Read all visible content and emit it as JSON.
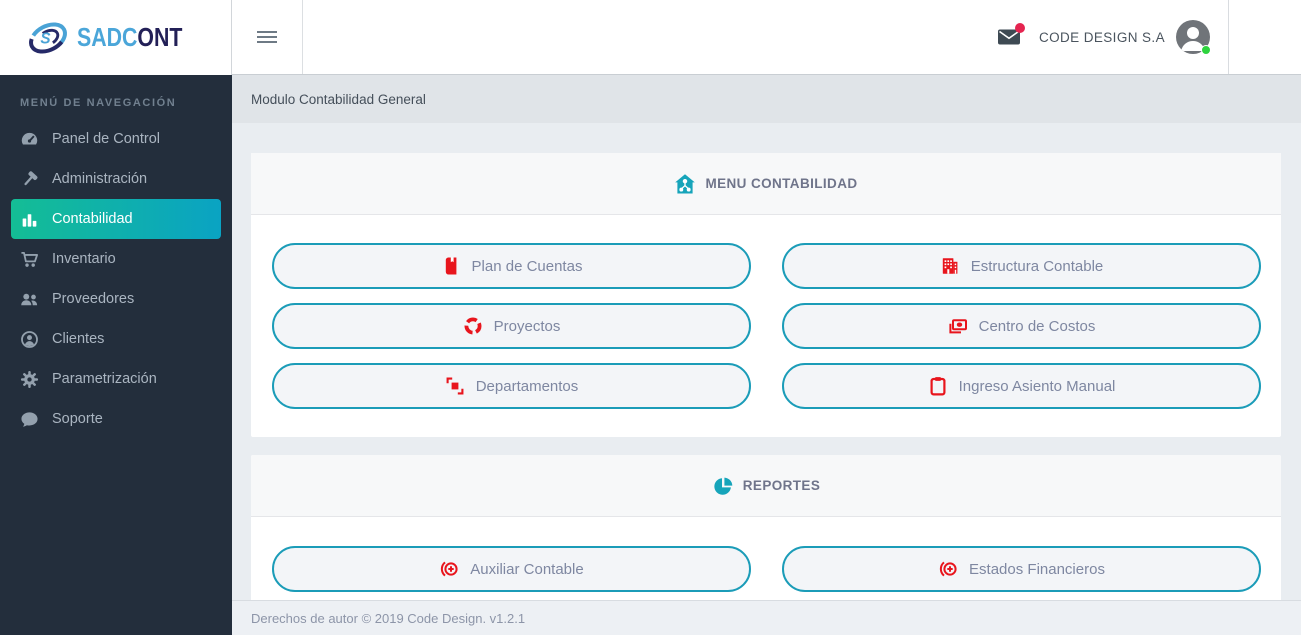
{
  "brand": {
    "name_primary": "SADC",
    "name_secondary": "ONT"
  },
  "topbar": {
    "company": "CODE DESIGN S.A",
    "icons": [
      "hamburger-icon",
      "envelope-icon",
      "avatar"
    ],
    "notification_dot_color": "#e52450",
    "status_dot_color": "#2ed33e"
  },
  "sidebar": {
    "section_label": "MENÚ DE NAVEGACIÓN",
    "items": [
      {
        "label": "Panel de Control",
        "icon": "gauge-icon",
        "active": false
      },
      {
        "label": "Administración",
        "icon": "hammer-icon",
        "active": false
      },
      {
        "label": "Contabilidad",
        "icon": "bar-chart-icon",
        "active": true
      },
      {
        "label": "Inventario",
        "icon": "cart-icon",
        "active": false
      },
      {
        "label": "Proveedores",
        "icon": "users-icon",
        "active": false
      },
      {
        "label": "Clientes",
        "icon": "user-circle-icon",
        "active": false
      },
      {
        "label": "Parametrización",
        "icon": "gear-icon",
        "active": false
      },
      {
        "label": "Soporte",
        "icon": "chat-icon",
        "active": false
      }
    ],
    "active_gradient": [
      "#14bd95",
      "#0aa3c3"
    ]
  },
  "breadcrumb": {
    "title": "Modulo Contabilidad General"
  },
  "sections": [
    {
      "title": "MENU CONTABILIDAD",
      "icon": "home-network-icon",
      "buttons": [
        {
          "label": "Plan de Cuentas",
          "icon": "book-icon"
        },
        {
          "label": "Estructura Contable",
          "icon": "building-icon"
        },
        {
          "label": "Proyectos",
          "icon": "ring-icon"
        },
        {
          "label": "Centro de Costos",
          "icon": "money-icon"
        },
        {
          "label": "Departamentos",
          "icon": "squares-icon"
        },
        {
          "label": "Ingreso Asiento Manual",
          "icon": "clipboard-icon"
        }
      ]
    },
    {
      "title": "REPORTES",
      "icon": "pie-chart-icon",
      "buttons": [
        {
          "label": "Auxiliar Contable",
          "icon": "circle-plus-icon"
        },
        {
          "label": "Estados Financieros",
          "icon": "circle-plus-icon"
        }
      ]
    }
  ],
  "footer": {
    "text": "Derechos de autor © 2019 Code Design. v1.2.1"
  },
  "colors": {
    "accent_teal": "#1b9cb8",
    "icon_red": "#e8151d",
    "sidebar_bg": "#232e3c",
    "content_bg": "#e9edf1"
  }
}
